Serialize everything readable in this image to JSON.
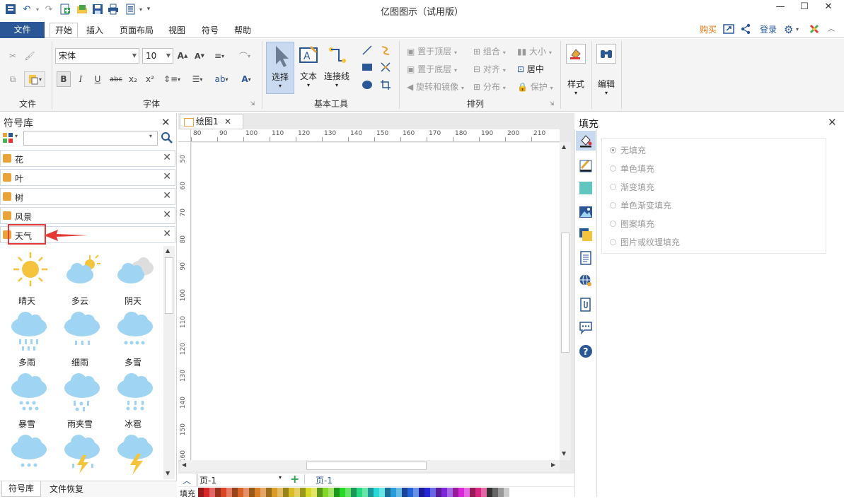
{
  "app": {
    "title": "亿图图示（试用版）",
    "window_controls": [
      "—",
      "☐",
      "✕"
    ]
  },
  "quick_access": [
    "logo",
    "undo",
    "redo",
    "new",
    "open",
    "save",
    "print",
    "export"
  ],
  "menu": {
    "file": "文件",
    "tabs": [
      "开始",
      "插入",
      "页面布局",
      "视图",
      "符号",
      "帮助"
    ],
    "active_tab": "开始",
    "right": {
      "buy": "购买",
      "login": "登录"
    }
  },
  "ribbon": {
    "groups": {
      "file": "文件",
      "font": "字体",
      "basic_tools": "基本工具",
      "arrange": "排列"
    },
    "font": {
      "family": "宋体",
      "size": "10"
    },
    "format_buttons": [
      "B",
      "I",
      "U",
      "abc",
      "x₂",
      "x²"
    ],
    "tools": {
      "select": "选择",
      "text": "文本",
      "connector": "连接线"
    },
    "arrange": {
      "bring_front": "置于顶层",
      "send_back": "置于底层",
      "rotate_mirror": "旋转和镜像",
      "group": "组合",
      "align": "对齐",
      "distribute": "分布",
      "size": "大小",
      "center": "居中",
      "protect": "保护"
    },
    "style": "样式",
    "edit": "编辑"
  },
  "symbol_library": {
    "title": "符号库",
    "search_placeholder": "",
    "categories": [
      "花",
      "叶",
      "树",
      "风景",
      "天气"
    ],
    "highlighted_category": "天气",
    "symbols": [
      "晴天",
      "多云",
      "阴天",
      "多雨",
      "细雨",
      "多雪",
      "暴雪",
      "雨夹雪",
      "冰雹"
    ],
    "bottom_tabs": [
      "符号库",
      "文件恢复"
    ]
  },
  "document": {
    "tab": "绘图1",
    "ruler_h": [
      "80",
      "90",
      "100",
      "110",
      "120",
      "130",
      "140",
      "150",
      "160",
      "170",
      "180",
      "190",
      "200",
      "210"
    ],
    "ruler_v": [
      "50",
      "60",
      "70",
      "80",
      "90",
      "100",
      "110",
      "120",
      "130",
      "140",
      "150",
      "160"
    ],
    "page_select": "页-1",
    "page_tab": "页-1",
    "fill_label": "填充"
  },
  "fill_panel": {
    "title": "填充",
    "options": [
      "无填充",
      "单色填充",
      "渐变填充",
      "单色渐变填充",
      "图案填充",
      "图片或纹理填充"
    ],
    "selected": "无填充"
  },
  "colors": {
    "accent": "#2b5797",
    "highlight": "#e53935",
    "weather_blue": "#9fd4f2",
    "sun_yellow": "#f6c33d"
  }
}
